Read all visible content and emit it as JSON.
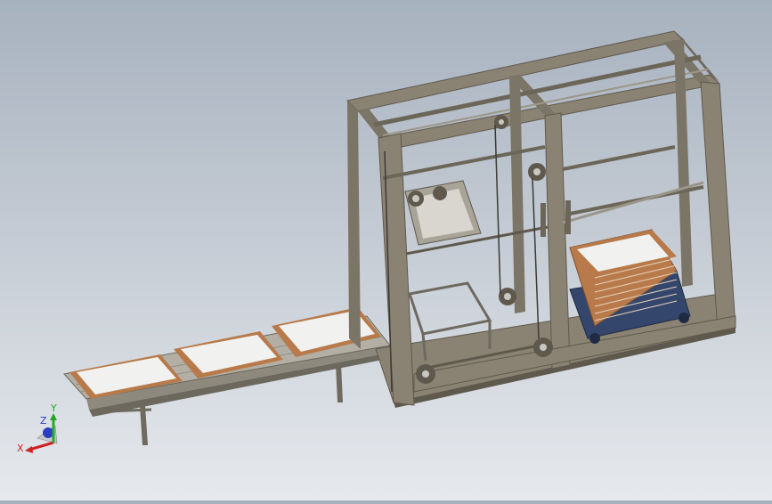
{
  "viewport": {
    "background_top": "#a7b2bf",
    "background_bottom": "#e6e9ed",
    "model_colors": {
      "frame": "#8a8373",
      "frame_dark": "#5f594d",
      "conveyor_rail": "#9a958a",
      "tray_edge": "#b87a4a",
      "tray_fill": "#f1f1ef",
      "cart": "#34466b",
      "metal": "#c9c7c2"
    }
  },
  "triad": {
    "x_label": "X",
    "y_label": "Y",
    "z_label": "Z",
    "x_color": "#cc2222",
    "y_color": "#22aa22",
    "z_color": "#2a3fbf"
  }
}
